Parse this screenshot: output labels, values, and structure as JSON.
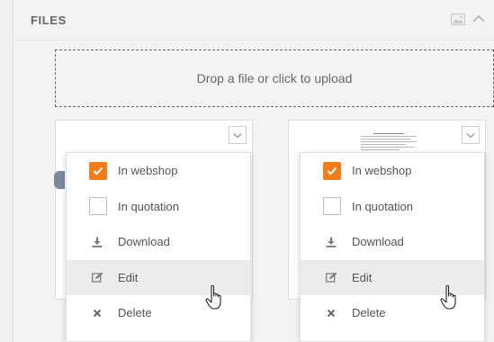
{
  "header": {
    "title": "FILES"
  },
  "dropzone": {
    "label": "Drop a file or click to upload"
  },
  "menus": [
    {
      "items": [
        {
          "label": "In webshop",
          "checked": true
        },
        {
          "label": "In quotation",
          "checked": false
        },
        {
          "label": "Download"
        },
        {
          "label": "Edit"
        },
        {
          "label": "Delete"
        }
      ]
    },
    {
      "items": [
        {
          "label": "In webshop",
          "checked": true
        },
        {
          "label": "In quotation",
          "checked": false
        },
        {
          "label": "Download"
        },
        {
          "label": "Edit"
        },
        {
          "label": "Delete"
        }
      ]
    }
  ],
  "colors": {
    "accent": "#f07c1a"
  }
}
